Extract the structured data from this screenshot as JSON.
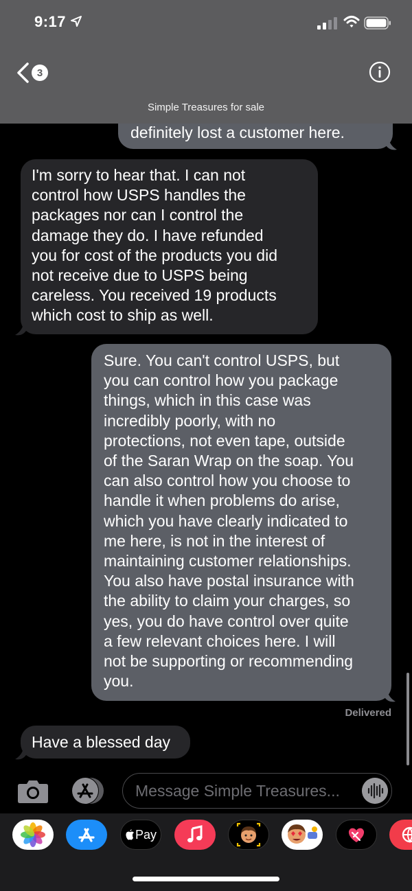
{
  "status": {
    "time": "9:17"
  },
  "nav": {
    "back_count": "3",
    "contact": "Simple Treasures for sale"
  },
  "messages": {
    "m1": "definitely lost a customer here.",
    "m2": "I'm sorry to hear that.  I can not\ncontrol how USPS handles the\npackages nor can I control the\ndamage they do.  I have refunded\nyou for cost of the products you did\nnot receive due to USPS being\ncareless.  You received 19 products\nwhich cost to ship as well.",
    "m3": "Sure. You can't control USPS, but\nyou can control how you package\nthings, which in this case was\nincredibly poorly, with no\nprotections, not even tape, outside\nof the Saran Wrap on the soap. You\ncan also control how you choose to\nhandle it when problems do arise,\nwhich you have clearly indicated to\nme here, is not in the interest of\nmaintaining customer relationships.\nYou also have postal insurance with\nthe ability to claim your charges, so\nyes, you do have control over quite\na few relevant choices here. I will\nnot be supporting or recommending\nyou.",
    "delivered": "Delivered",
    "m4": "Have a blessed day"
  },
  "input": {
    "placeholder": "Message Simple Treasures..."
  },
  "apps": {
    "items": [
      "photos-icon",
      "app-store-icon",
      "apple-pay-icon",
      "music-icon",
      "memoji-icon",
      "animoji-icon",
      "digital-touch-icon",
      "web-images-icon"
    ],
    "apple_pay_label": "Pay"
  },
  "colors": {
    "header": "#5c5c5e",
    "sent_bubble": "#5c5f66",
    "received_bubble": "#262629",
    "drawer": "#1c1c1e"
  }
}
